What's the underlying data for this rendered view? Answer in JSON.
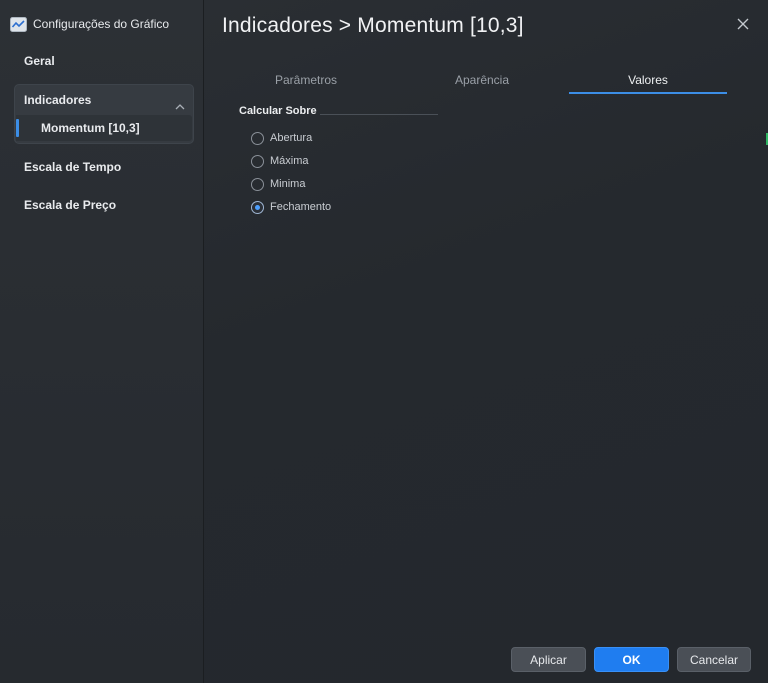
{
  "window": {
    "app_title": "Configurações do Gráfico"
  },
  "sidebar": {
    "items": [
      {
        "label": "Geral"
      },
      {
        "label": "Indicadores",
        "expanded": true,
        "children": [
          {
            "label": "Momentum [10,3]",
            "selected": true
          }
        ]
      },
      {
        "label": "Escala de Tempo"
      },
      {
        "label": "Escala de Preço"
      }
    ]
  },
  "header": {
    "title": "Indicadores > Momentum [10,3]"
  },
  "tabs": [
    {
      "label": "Parâmetros",
      "active": false
    },
    {
      "label": "Aparência",
      "active": false
    },
    {
      "label": "Valores",
      "active": true
    }
  ],
  "calculate_on": {
    "title": "Calcular Sobre",
    "options": [
      {
        "label": "Abertura",
        "checked": false
      },
      {
        "label": "Máxima",
        "checked": false
      },
      {
        "label": "Minima",
        "checked": false
      },
      {
        "label": "Fechamento",
        "checked": true
      }
    ]
  },
  "footer": {
    "apply_label": "Aplicar",
    "ok_label": "OK",
    "cancel_label": "Cancelar"
  },
  "icons": {
    "app": "chart-line-icon",
    "close": "close-icon",
    "collapse": "chevron-up-icon"
  },
  "colors": {
    "accent": "#3c8ee6",
    "primary_button": "#1f7df0",
    "radio_selected": "#4da0ff"
  }
}
